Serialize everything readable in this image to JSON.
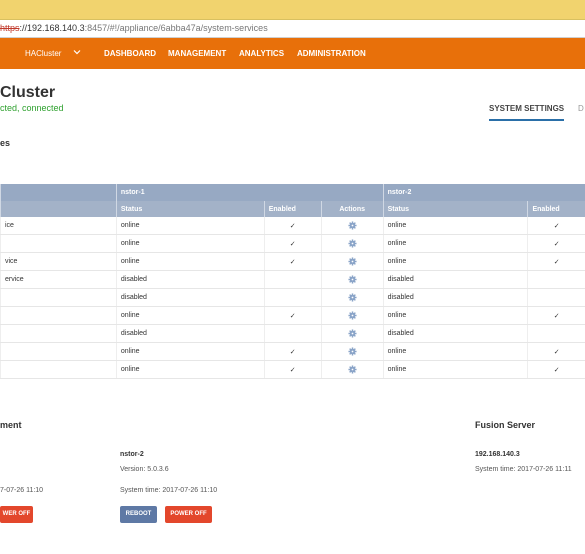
{
  "browser": {
    "url_proto": "https",
    "url_host": "://192.168.140.3",
    "url_rest": ":8457/#!/appliance/6abba47a/system-services"
  },
  "nav": {
    "cluster": "HACluster",
    "items": [
      "DASHBOARD",
      "MANAGEMENT",
      "ANALYTICS",
      "ADMINISTRATION"
    ]
  },
  "page": {
    "title": "Cluster",
    "status": "cted, connected",
    "tab_active": "SYSTEM SETTINGS",
    "tab_next": "D",
    "section": "es"
  },
  "table": {
    "node1": "nstor-1",
    "node2": "nstor-2",
    "cols": [
      "Status",
      "Enabled",
      "Actions",
      "Status",
      "Enabled"
    ],
    "rows": [
      {
        "name": "ice",
        "s1": "online",
        "e1": "✓",
        "s2": "online",
        "e2": "✓"
      },
      {
        "name": "",
        "s1": "online",
        "e1": "✓",
        "s2": "online",
        "e2": "✓"
      },
      {
        "name": "vice",
        "s1": "online",
        "e1": "✓",
        "s2": "online",
        "e2": "✓"
      },
      {
        "name": "ervice",
        "s1": "disabled",
        "e1": "",
        "s2": "disabled",
        "e2": ""
      },
      {
        "name": "",
        "s1": "disabled",
        "e1": "",
        "s2": "disabled",
        "e2": ""
      },
      {
        "name": "",
        "s1": "online",
        "e1": "✓",
        "s2": "online",
        "e2": "✓"
      },
      {
        "name": "",
        "s1": "disabled",
        "e1": "",
        "s2": "disabled",
        "e2": ""
      },
      {
        "name": "",
        "s1": "online",
        "e1": "✓",
        "s2": "online",
        "e2": "✓"
      },
      {
        "name": "",
        "s1": "online",
        "e1": "✓",
        "s2": "online",
        "e2": "✓"
      }
    ]
  },
  "management": {
    "title": "ment",
    "left_time": "7-07-26 11:10",
    "left_button": "WER OFF",
    "node_name": "nstor-2",
    "node_version": "Version: 5.0.3.6",
    "node_time": "System time: 2017-07-26 11:10",
    "reboot": "REBOOT",
    "poweroff": "POWER OFF"
  },
  "fusion": {
    "title": "Fusion Server",
    "ip": "192.168.140.3",
    "time": "System time: 2017-07-26 11:11"
  }
}
